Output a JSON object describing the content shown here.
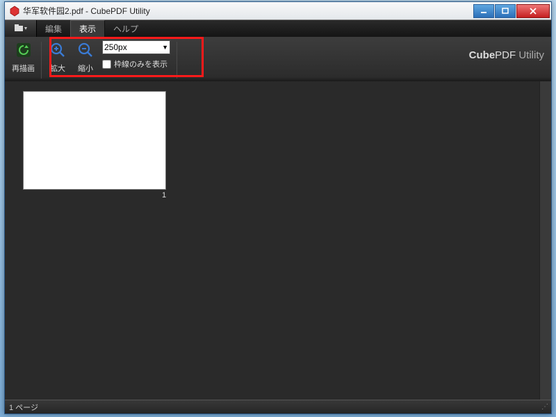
{
  "titlebar": {
    "title": "华军软件园2.pdf - CubePDF Utility"
  },
  "menubar": {
    "edit": "編集",
    "view": "表示",
    "help": "ヘルプ"
  },
  "ribbon": {
    "redraw": "再描画",
    "zoomin": "拡大",
    "zoomout": "縮小",
    "zoom_value": "250px",
    "frame_only": "枠線のみを表示",
    "brand_prefix": "Cube",
    "brand_mid": "PDF",
    "brand_suffix": " Utility"
  },
  "thumbs": {
    "page1_number": "1"
  },
  "statusbar": {
    "text": "1 ページ"
  }
}
